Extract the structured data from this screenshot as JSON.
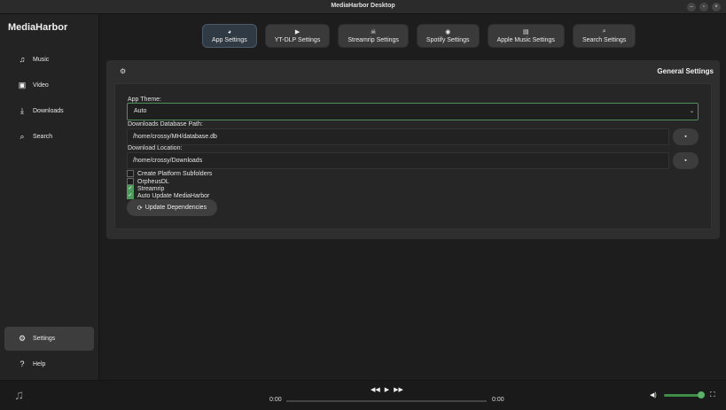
{
  "window": {
    "title": "MediaHarbor Desktop"
  },
  "sidebar": {
    "brand": "MediaHarbor",
    "items": [
      {
        "label": "Music",
        "icon": "music-icon"
      },
      {
        "label": "Video",
        "icon": "video-icon"
      },
      {
        "label": "Downloads",
        "icon": "download-icon"
      },
      {
        "label": "Search",
        "icon": "search-icon"
      }
    ],
    "settings": {
      "label": "Settings",
      "icon": "gears-icon"
    },
    "help": {
      "label": "Help",
      "icon": "help-icon"
    }
  },
  "tabs": [
    {
      "label": "App Settings",
      "icon": "app-icon"
    },
    {
      "label": "YT-DLP Settings",
      "icon": "youtube-icon"
    },
    {
      "label": "Streamrip Settings",
      "icon": "skull-icon"
    },
    {
      "label": "Spotify Settings",
      "icon": "spotify-icon"
    },
    {
      "label": "Apple Music Settings",
      "icon": "apple-music-icon"
    },
    {
      "label": "Search Settings",
      "icon": "search-icon"
    }
  ],
  "panel": {
    "title": "General Settings",
    "app_theme_label": "App Theme:",
    "app_theme_value": "Auto",
    "db_path_label": "Downloads Database Path:",
    "db_path_value": "/home/crossy/MH/database.db",
    "download_location_label": "Download Location:",
    "download_location_value": "/home/crossy/Downloads",
    "checkboxes": [
      {
        "label": "Create Platform Subfolders",
        "checked": false
      },
      {
        "label": "OrpheusDL",
        "checked": false
      },
      {
        "label": "Streamrip",
        "checked": true
      },
      {
        "label": "Auto Update MediaHarbor",
        "checked": true
      }
    ],
    "update_button": "Update Dependencies"
  },
  "player": {
    "time_current": "0:00",
    "time_total": "0:00",
    "volume_level": 0.9
  },
  "colors": {
    "accent": "#4d9a5c",
    "background": "#1c1c1c"
  }
}
